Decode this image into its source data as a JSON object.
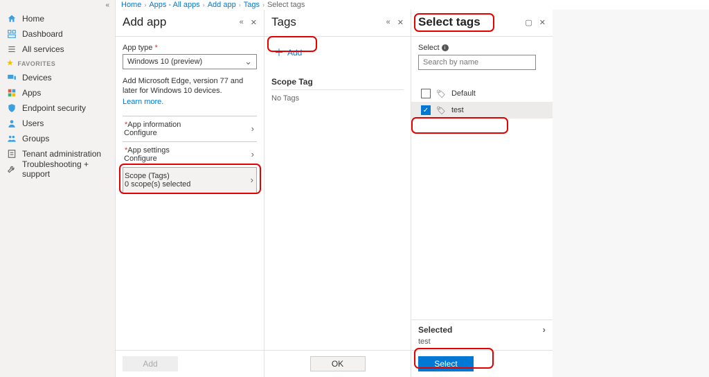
{
  "sidebar": {
    "items": [
      {
        "label": "Home",
        "icon": "home"
      },
      {
        "label": "Dashboard",
        "icon": "dashboard"
      },
      {
        "label": "All services",
        "icon": "services"
      }
    ],
    "favorites_label": "FAVORITES",
    "fav_items": [
      {
        "label": "Devices",
        "icon": "devices"
      },
      {
        "label": "Apps",
        "icon": "apps"
      },
      {
        "label": "Endpoint security",
        "icon": "shield"
      },
      {
        "label": "Users",
        "icon": "user"
      },
      {
        "label": "Groups",
        "icon": "group"
      },
      {
        "label": "Tenant administration",
        "icon": "tenant"
      },
      {
        "label": "Troubleshooting + support",
        "icon": "wrench"
      }
    ]
  },
  "breadcrumb": {
    "items": [
      "Home",
      "Apps - All apps",
      "Add app",
      "Tags"
    ],
    "current": "Select tags"
  },
  "blade1": {
    "title": "Add app",
    "app_type_label": "App type",
    "app_type_value": "Windows 10 (preview)",
    "info": "Add Microsoft Edge, version 77 and later for Windows 10 devices.",
    "learn_more": "Learn more.",
    "sections": [
      {
        "label": "App information",
        "sub": "Configure"
      },
      {
        "label": "App settings",
        "sub": "Configure"
      },
      {
        "label": "Scope (Tags)",
        "sub": "0 scope(s) selected"
      }
    ],
    "add_btn": "Add"
  },
  "blade2": {
    "title": "Tags",
    "add_label": "Add",
    "scope_tag": "Scope Tag",
    "no_tags": "No Tags",
    "ok_btn": "OK"
  },
  "blade3": {
    "title": "Select tags",
    "select_label": "Select",
    "search_placeholder": "Search by name",
    "tags": [
      {
        "name": "Default",
        "checked": false
      },
      {
        "name": "test",
        "checked": true
      }
    ],
    "selected_label": "Selected",
    "selected_value": "test",
    "select_btn": "Select"
  }
}
